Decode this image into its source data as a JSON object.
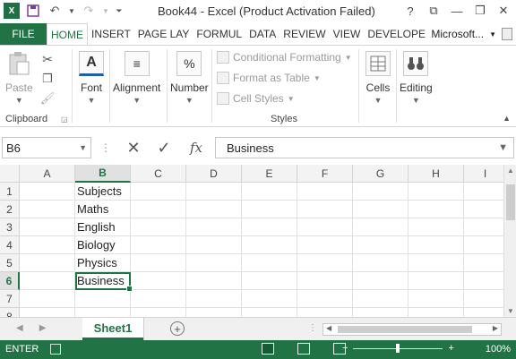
{
  "app": {
    "title": "Book44 - Excel (Product Activation Failed)",
    "logo_text": "X",
    "window_controls": [
      "?",
      "⧉",
      "—",
      "❐",
      "✕"
    ]
  },
  "ribbon_tabs": {
    "file": "FILE",
    "items": [
      "HOME",
      "INSERT",
      "PAGE LAY",
      "FORMUL",
      "DATA",
      "REVIEW",
      "VIEW",
      "DEVELOPE"
    ],
    "active": "HOME",
    "account": "Microsoft..."
  },
  "ribbon": {
    "clipboard": {
      "paste": "Paste",
      "label": "Clipboard"
    },
    "font": {
      "label": "Font"
    },
    "alignment": {
      "label": "Alignment"
    },
    "number": {
      "label": "Number",
      "icon_text": "%"
    },
    "styles": {
      "conditional": "Conditional Formatting",
      "table": "Format as Table",
      "cell_styles": "Cell Styles",
      "label": "Styles"
    },
    "cells": {
      "label": "Cells"
    },
    "editing": {
      "label": "Editing"
    }
  },
  "formula_bar": {
    "name_box": "B6",
    "cancel": "✕",
    "enter": "✓",
    "fx": "fx",
    "value": "Business"
  },
  "grid": {
    "columns": [
      "A",
      "B",
      "C",
      "D",
      "E",
      "F",
      "G",
      "H",
      "I"
    ],
    "selected_column": "B",
    "rows": [
      {
        "n": "1",
        "b": "Subjects"
      },
      {
        "n": "2",
        "b": "Maths"
      },
      {
        "n": "3",
        "b": "English"
      },
      {
        "n": "4",
        "b": "Biology"
      },
      {
        "n": "5",
        "b": "Physics"
      },
      {
        "n": "6",
        "b": "Business"
      },
      {
        "n": "7",
        "b": ""
      },
      {
        "n": "8",
        "b": ""
      }
    ],
    "active_cell": "B6"
  },
  "sheets": {
    "active": "Sheet1",
    "add": "+"
  },
  "status": {
    "mode": "ENTER",
    "zoom": "100%"
  },
  "colors": {
    "accent": "#217346"
  }
}
